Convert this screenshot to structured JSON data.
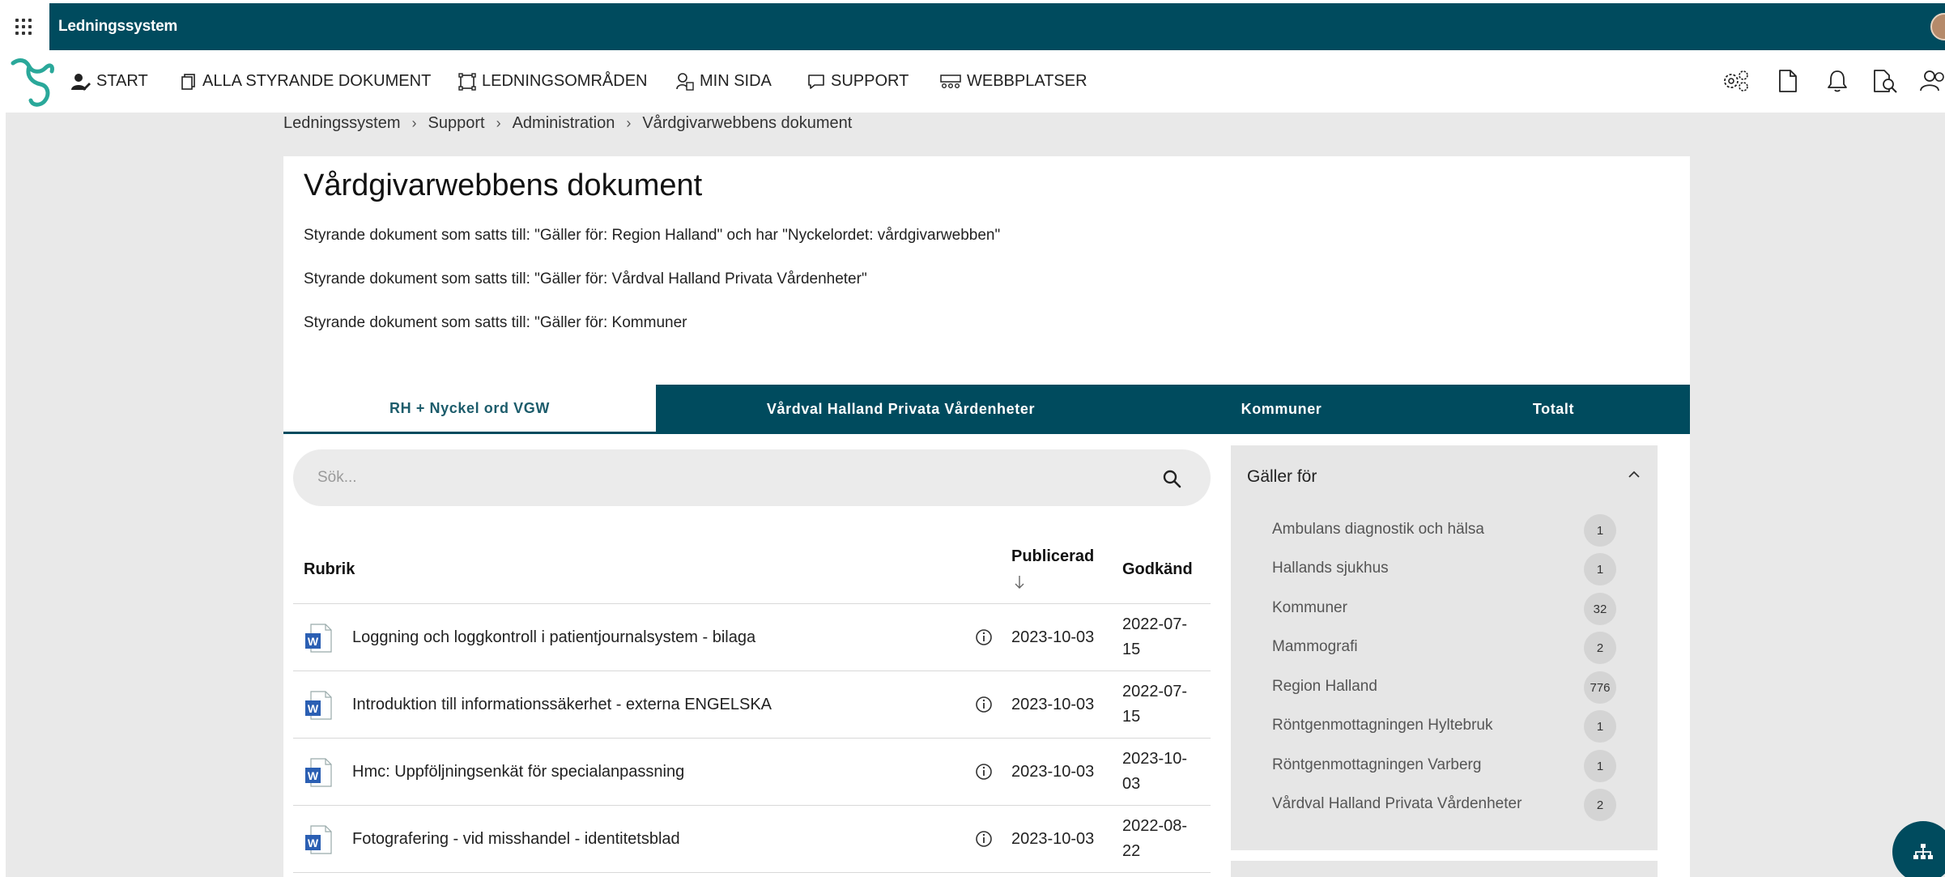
{
  "app": {
    "title": "Ledningssystem"
  },
  "nav": {
    "items": [
      {
        "label": "START",
        "icon": "user-edit-icon"
      },
      {
        "label": "ALLA STYRANDE DOKUMENT",
        "icon": "documents-icon"
      },
      {
        "label": "LEDNINGSOMRÅDEN",
        "icon": "area-icon"
      },
      {
        "label": "MIN SIDA",
        "icon": "user-page-icon"
      },
      {
        "label": "SUPPORT",
        "icon": "chat-icon"
      },
      {
        "label": "WEBBPLATSER",
        "icon": "sites-icon"
      }
    ],
    "right_icons": [
      "settings-gears-icon",
      "document-icon",
      "bell-icon",
      "document-search-icon",
      "users-icon"
    ]
  },
  "breadcrumb": [
    "Ledningssystem",
    "Support",
    "Administration",
    "Vårdgivarwebbens dokument"
  ],
  "page": {
    "title": "Vårdgivarwebbens dokument",
    "descriptions": [
      "Styrande dokument som satts till: \"Gäller för: Region Halland\" och har \"Nyckelordet: vårdgivarwebben\"",
      "Styrande dokument som satts till: \"Gäller för: Vårdval Halland Privata Vårdenheter\"",
      "Styrande dokument som satts till: \"Gäller för: Kommuner"
    ]
  },
  "tabs": [
    {
      "label": "RH + Nyckel ord VGW",
      "active": true
    },
    {
      "label": "Vårdval Halland Privata Vårdenheter",
      "active": false
    },
    {
      "label": "Kommuner",
      "active": false
    },
    {
      "label": "Totalt",
      "active": false
    }
  ],
  "search": {
    "placeholder": "Sök...",
    "value": ""
  },
  "table": {
    "headers": {
      "title": "Rubrik",
      "published": "Publicerad",
      "approved": "Godkänd"
    },
    "rows": [
      {
        "title": "Loggning och loggkontroll i patientjournalsystem - bilaga",
        "published": "2023-10-03",
        "approved_line1": "2022-07-",
        "approved_line2": "15"
      },
      {
        "title": "Introduktion till informationssäkerhet - externa ENGELSKA",
        "published": "2023-10-03",
        "approved_line1": "2022-07-",
        "approved_line2": "15"
      },
      {
        "title": "Hmc: Uppföljningsenkät för specialanpassning",
        "published": "2023-10-03",
        "approved_line1": "2023-10-",
        "approved_line2": "03"
      },
      {
        "title": "Fotografering - vid misshandel - identitetsblad",
        "published": "2023-10-03",
        "approved_line1": "2022-08-",
        "approved_line2": "22"
      }
    ]
  },
  "filter": {
    "title": "Gäller för",
    "items": [
      {
        "label": "Ambulans diagnostik och hälsa",
        "count": "1"
      },
      {
        "label": "Hallands sjukhus",
        "count": "1"
      },
      {
        "label": "Kommuner",
        "count": "32"
      },
      {
        "label": "Mammografi",
        "count": "2"
      },
      {
        "label": "Region Halland",
        "count": "776"
      },
      {
        "label": "Röntgenmottagningen Hyltebruk",
        "count": "1"
      },
      {
        "label": "Röntgenmottagningen Varberg",
        "count": "1"
      },
      {
        "label": "Vårdval Halland Privata Vårdenheter",
        "count": "2"
      }
    ]
  },
  "colors": {
    "brand": "#004b5e",
    "logo": "#2aa89a"
  }
}
